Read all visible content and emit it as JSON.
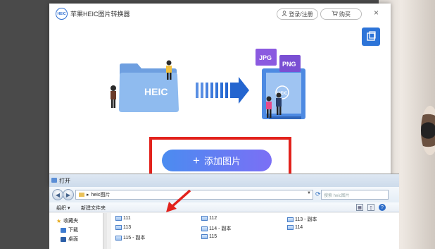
{
  "app": {
    "logo_text": "HEIC",
    "title": "苹果HEIC图片转换器",
    "login_label": "登录/注册",
    "buy_label": "购买",
    "close_glyph": "×",
    "add_button_label": "添加图片",
    "add_plus_glyph": "+",
    "folder_label": "HEIC",
    "badge_jpg": "JPG",
    "badge_png": "PNG",
    "screen_logo": "HEIC"
  },
  "dialog": {
    "title": "打开",
    "address_path": "heic图片",
    "address_arrow": "▸",
    "search_placeholder": "搜索 heic图片",
    "toolbar": {
      "organize": "组织 ▾",
      "new_folder": "新建文件夹"
    },
    "nav_items": [
      {
        "label": "收藏夹",
        "icon": "star-icon"
      },
      {
        "label": "下载",
        "icon": "download-folder-icon"
      },
      {
        "label": "桌面",
        "icon": "desktop-icon"
      }
    ],
    "files": [
      {
        "name": "111"
      },
      {
        "name": "112"
      },
      {
        "name": "113 - 副本"
      },
      {
        "name": "113"
      },
      {
        "name": "114 - 副本"
      },
      {
        "name": "114"
      },
      {
        "name": "115 - 副本"
      },
      {
        "name": "115"
      }
    ]
  },
  "colors": {
    "accent": "#2f6fd1",
    "highlight_box": "#e2221c",
    "button_gradient_start": "#4b8cf0",
    "button_gradient_end": "#7b6ff5"
  }
}
